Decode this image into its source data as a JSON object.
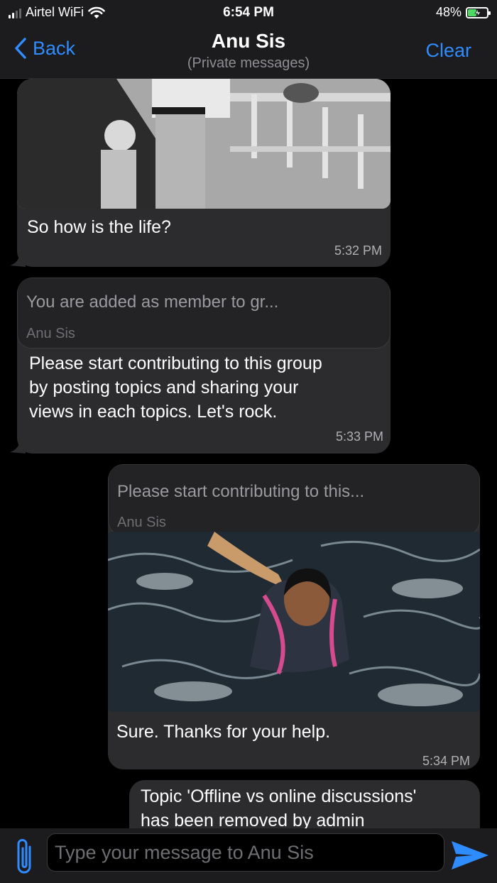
{
  "status_bar": {
    "carrier": "Airtel WiFi",
    "time": "6:54 PM",
    "battery": "48%",
    "battery_level": 0.48
  },
  "nav": {
    "back_label": "Back",
    "title": "Anu Sis",
    "subtitle": "(Private messages)",
    "clear_label": "Clear"
  },
  "messages": [
    {
      "direction": "incoming",
      "has_image": true,
      "image_subject": "street-photo",
      "text": "So how is the life?",
      "time": "5:32 PM"
    },
    {
      "direction": "incoming",
      "reply_snippet": "You are added as member to gr...",
      "reply_author": "Anu Sis",
      "text_lines": [
        "Please start contributing to this group",
        "by posting topics and sharing your",
        "views in each topics. Let's rock."
      ],
      "time": "5:33 PM"
    },
    {
      "direction": "outgoing",
      "reply_snippet": "Please start contributing to this...",
      "reply_author": "Anu Sis",
      "has_image": true,
      "image_subject": "swimming-photo",
      "text": "Sure. Thanks for your help.",
      "time": "5:34 PM"
    },
    {
      "direction": "outgoing",
      "text_lines": [
        "Topic 'Offline vs online discussions'",
        "has been removed by admin"
      ]
    }
  ],
  "composer": {
    "placeholder": "Type your message to Anu Sis",
    "value": ""
  },
  "colors": {
    "accent": "#2f8cff",
    "bubble": "#2c2c2e",
    "background": "#000000",
    "battery_fill": "#4cd964"
  },
  "icons": [
    "wifi-icon",
    "battery-icon",
    "chevron-left-icon",
    "paperclip-icon",
    "send-icon"
  ]
}
